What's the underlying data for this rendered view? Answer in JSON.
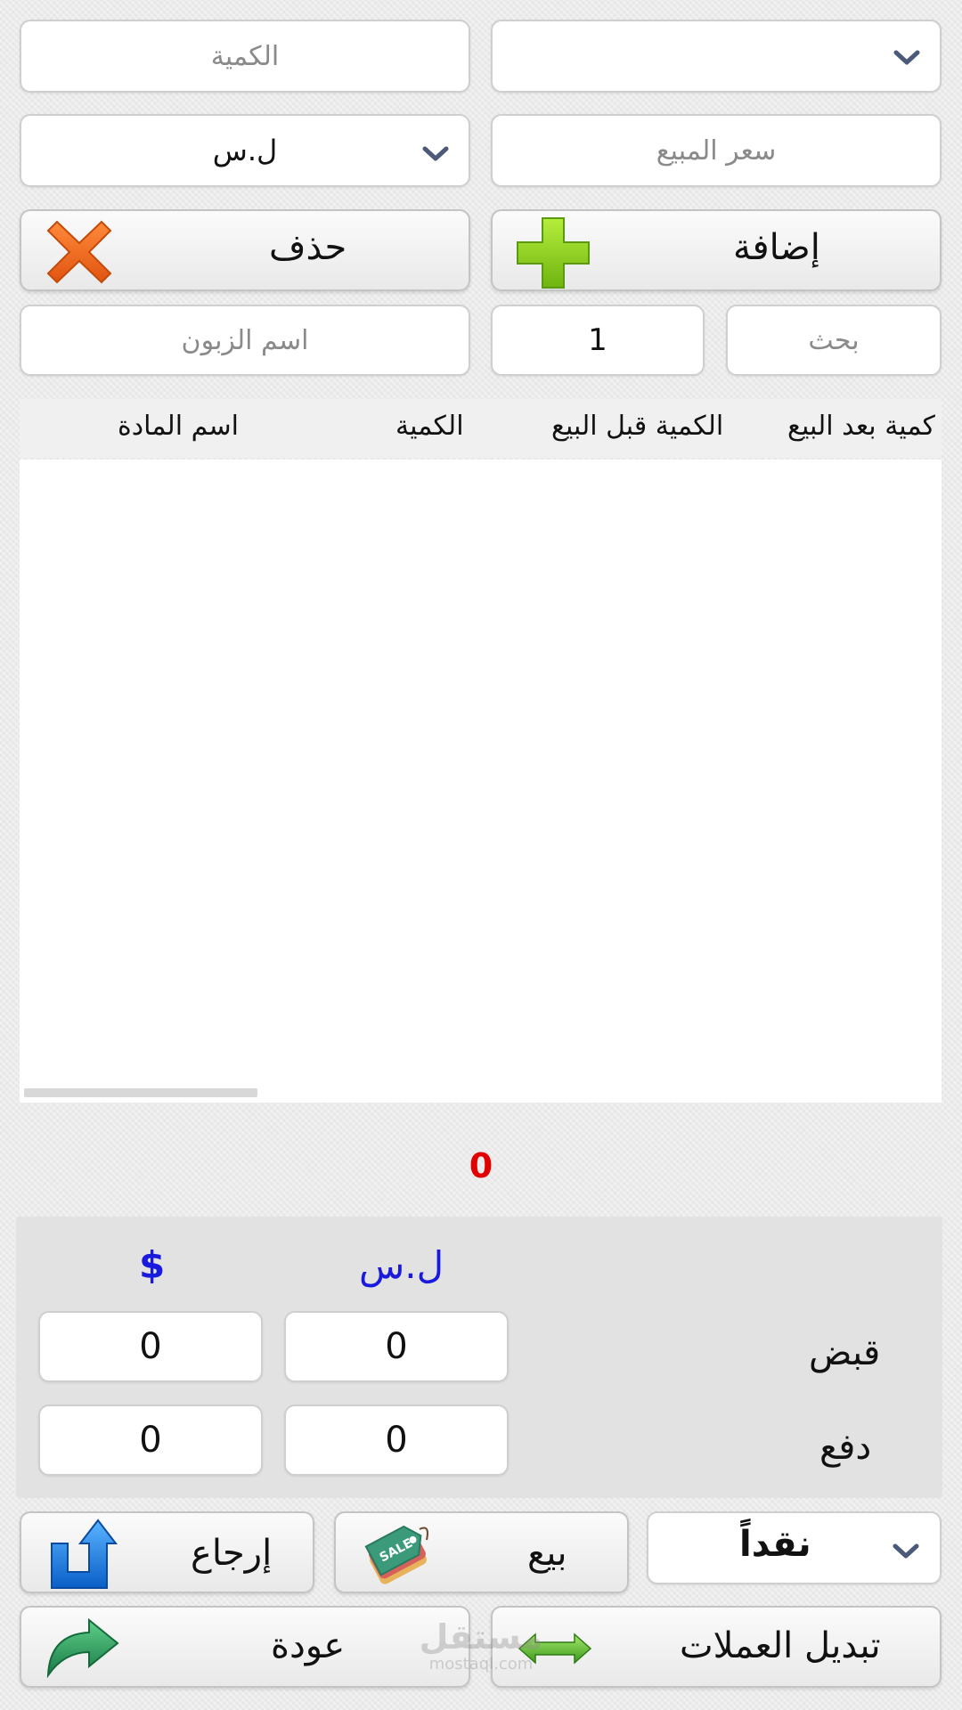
{
  "form": {
    "product_select_value": "",
    "quantity_placeholder": "الكمية",
    "sale_price_placeholder": "سعر المبيع",
    "currency_select_value": "ل.س",
    "add_label": "إضافة",
    "delete_label": "حذف",
    "search_placeholder": "بحث",
    "count_value": "1",
    "customer_placeholder": "اسم الزبون"
  },
  "table": {
    "columns": [
      "كمية بعد البيع",
      "الكمية قبل البيع",
      "الكمية",
      "اسم المادة"
    ],
    "rows": []
  },
  "total": "0",
  "summary": {
    "currency_syp": "ل.س",
    "currency_usd": "$",
    "receive_label": "قبض",
    "pay_label": "دفع",
    "receive_syp": "0",
    "receive_usd": "0",
    "pay_syp": "0",
    "pay_usd": "0"
  },
  "actions": {
    "payment_type": "نقداً",
    "sell_label": "بيع",
    "return_label": "إرجاع",
    "exchange_label": "تبديل العملات",
    "back_label": "عودة"
  },
  "watermark": {
    "text": "مستقل",
    "subtext": "mostaql.com"
  },
  "colors": {
    "total": "#e30000",
    "currency_headers": "#1a1adf",
    "delete_icon": "#f06a1a",
    "add_icon": "#8fd21e",
    "chevron": "#4a5a78"
  },
  "icons": {
    "dropdown": "chevron-down-icon",
    "add": "green-plus-icon",
    "delete": "orange-x-icon",
    "sell": "sale-tag-icon",
    "return": "return-arrow-icon",
    "exchange": "double-arrow-icon",
    "back": "green-arrow-icon"
  }
}
